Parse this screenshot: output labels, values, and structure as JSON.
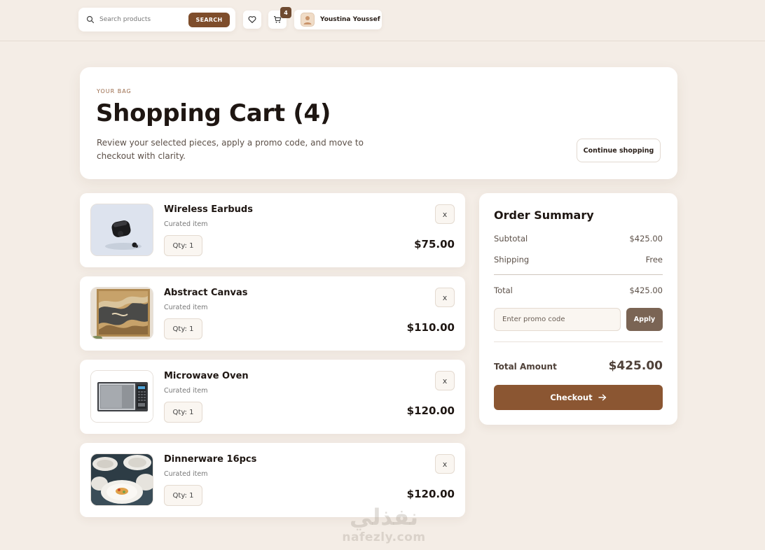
{
  "header": {
    "search_placeholder": "Search products",
    "search_button": "SEARCH",
    "cart_count": "4",
    "user_name": "Youstina Youssef"
  },
  "hero": {
    "eyebrow": "YOUR BAG",
    "title": "Shopping Cart (4)",
    "description": "Review your selected pieces, apply a promo code, and move to checkout with clarity.",
    "continue_label": "Continue shopping"
  },
  "items": [
    {
      "name": "Wireless Earbuds",
      "subtitle": "Curated item",
      "qty": "Qty: 1",
      "price": "$75.00",
      "remove": "x"
    },
    {
      "name": "Abstract Canvas",
      "subtitle": "Curated item",
      "qty": "Qty: 1",
      "price": "$110.00",
      "remove": "x"
    },
    {
      "name": "Microwave Oven",
      "subtitle": "Curated item",
      "qty": "Qty: 1",
      "price": "$120.00",
      "remove": "x"
    },
    {
      "name": "Dinnerware 16pcs",
      "subtitle": "Curated item",
      "qty": "Qty: 1",
      "price": "$120.00",
      "remove": "x"
    }
  ],
  "summary": {
    "title": "Order Summary",
    "subtotal_label": "Subtotal",
    "subtotal_value": "$425.00",
    "shipping_label": "Shipping",
    "shipping_value": "Free",
    "total_label": "Total",
    "total_value": "$425.00",
    "promo_placeholder": "Enter promo code",
    "apply_label": "Apply",
    "amount_label": "Total Amount",
    "amount_value": "$425.00",
    "checkout_label": "Checkout"
  },
  "watermark": {
    "arabic": "نفذلي",
    "latin": "nafezly.com"
  },
  "colors": {
    "background": "#f4ede6",
    "accent": "#8b5632",
    "accent_dark": "#7e4d2b",
    "apply": "#7a6454"
  },
  "icons": [
    "search-icon",
    "heart-icon",
    "cart-icon",
    "user-avatar-icon",
    "arrow-right-icon"
  ]
}
